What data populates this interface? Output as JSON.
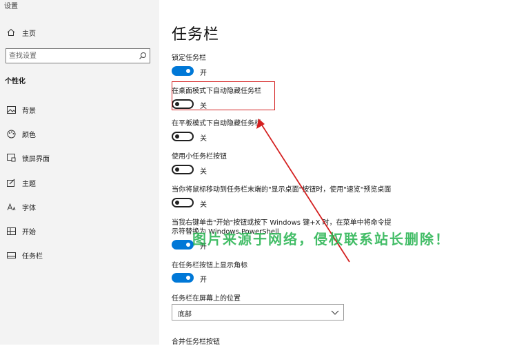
{
  "app": {
    "title": "设置"
  },
  "sidebar": {
    "home_label": "主页",
    "search_placeholder": "查找设置",
    "category": "个性化",
    "items": [
      {
        "label": "背景",
        "icon": "image-icon"
      },
      {
        "label": "颜色",
        "icon": "palette-icon"
      },
      {
        "label": "锁屏界面",
        "icon": "lock-screen-icon"
      },
      {
        "label": "主题",
        "icon": "theme-icon"
      },
      {
        "label": "字体",
        "icon": "font-icon"
      },
      {
        "label": "开始",
        "icon": "start-icon"
      },
      {
        "label": "任务栏",
        "icon": "taskbar-icon"
      }
    ]
  },
  "main": {
    "title": "任务栏",
    "settings": [
      {
        "label": "锁定任务栏",
        "state": "开",
        "on": true
      },
      {
        "label": "在桌面模式下自动隐藏任务栏",
        "state": "关",
        "on": false
      },
      {
        "label": "在平板模式下自动隐藏任务栏",
        "state": "关",
        "on": false
      },
      {
        "label": "使用小任务栏按钮",
        "state": "关",
        "on": false
      },
      {
        "label": "当你将鼠标移动到任务栏末端的\"显示桌面\"按钮时，使用\"速览\"预览桌面",
        "state": "关",
        "on": false
      },
      {
        "label_line1": "当我右键单击\"开始\"按钮或按下 Windows 键+X 时，在菜单中将命令提",
        "label_line2": "示符替换为 Windows PowerShell",
        "state": "开",
        "on": true
      },
      {
        "label": "在任务栏按钮上显示角标",
        "state": "开",
        "on": true
      }
    ],
    "position_label": "任务栏在屏幕上的位置",
    "position_value": "底部",
    "combine_label": "合并任务栏按钮"
  },
  "watermark": "图片来源于网络，侵权联系站长删除！",
  "colors": {
    "accent": "#0078d7",
    "highlight": "#d42020",
    "watermark": "#22b14c"
  }
}
